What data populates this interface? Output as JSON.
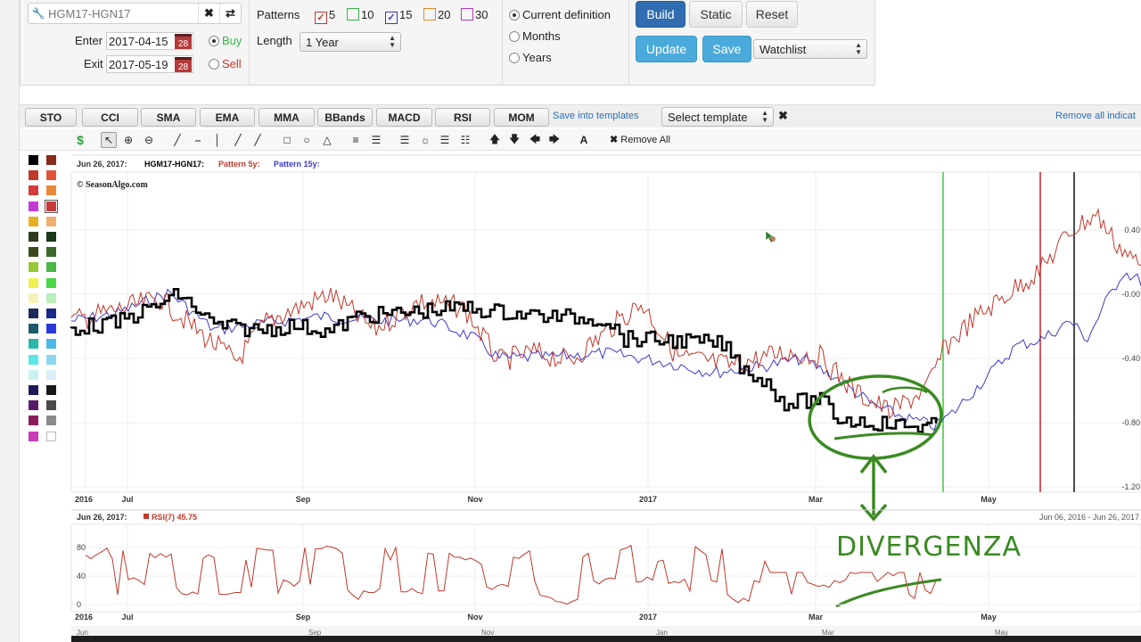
{
  "toolbar": {
    "symbol": "HGM17-HGN17",
    "enter_label": "Enter",
    "enter_date": "2017-04-15",
    "exit_label": "Exit",
    "exit_date": "2017-05-19",
    "calendar_day": "28",
    "buy_label": "Buy",
    "sell_label": "Sell",
    "patterns_label": "Patterns",
    "patterns": [
      {
        "label": "5",
        "checked": true,
        "color": "#c0392b"
      },
      {
        "label": "10",
        "checked": false,
        "color": "#3bb54a"
      },
      {
        "label": "15",
        "checked": true,
        "color": "#3a3ab8"
      },
      {
        "label": "20",
        "checked": false,
        "color": "#e08a2c"
      },
      {
        "label": "30",
        "checked": false,
        "color": "#b23ab8"
      }
    ],
    "length_label": "Length",
    "length_value": "1 Year",
    "range_options": [
      "Current definition",
      "Months",
      "Years"
    ],
    "build_label": "Build",
    "static_label": "Static",
    "reset_label": "Reset",
    "update_label": "Update",
    "save_label": "Save",
    "watchlist_value": "Watchlist"
  },
  "indicators": {
    "buttons": [
      "STO",
      "CCI",
      "SMA",
      "EMA",
      "MMA",
      "BBands",
      "MACD",
      "RSI",
      "MOM"
    ],
    "save_templates": "Save into templates",
    "select_template": "Select template",
    "remove_all": "Remove all indicat"
  },
  "drawing": {
    "remove_all": "Remove All"
  },
  "main_chart": {
    "date": "Jun 26, 2017:",
    "symbol": "HGM17-HGN17:",
    "pattern5": "Pattern 5y:",
    "pattern15": "Pattern 15y:",
    "copyright": "© SeasonAlgo.com",
    "x_labels": [
      "2016",
      "Jul",
      "Sep",
      "Nov",
      "2017",
      "Mar",
      "May"
    ],
    "y_labels": [
      "0.40",
      "-0.00",
      "-0.40",
      "-0.80",
      "-1.20"
    ],
    "annotation": "DIVERGENZA"
  },
  "rsi_chart": {
    "date": "Jun 26, 2017:",
    "label": "RSI(7) 45.75",
    "range": "Jun 06, 2016 - Jun 26, 2017",
    "y_labels": [
      "80",
      "40",
      "0"
    ],
    "x_labels": [
      "2016",
      "Jul",
      "Sep",
      "Nov",
      "2017",
      "Mar",
      "May"
    ],
    "nav_labels": [
      "Jun",
      "Sep",
      "Nov",
      "Jan",
      "Mar",
      "May"
    ]
  },
  "colors": {
    "primary": "#2f6db0",
    "info": "#4aaadb",
    "spread": "#000000",
    "pattern5": "#c0392b",
    "pattern15": "#3a3ad0",
    "annotation": "#3a8a22"
  }
}
